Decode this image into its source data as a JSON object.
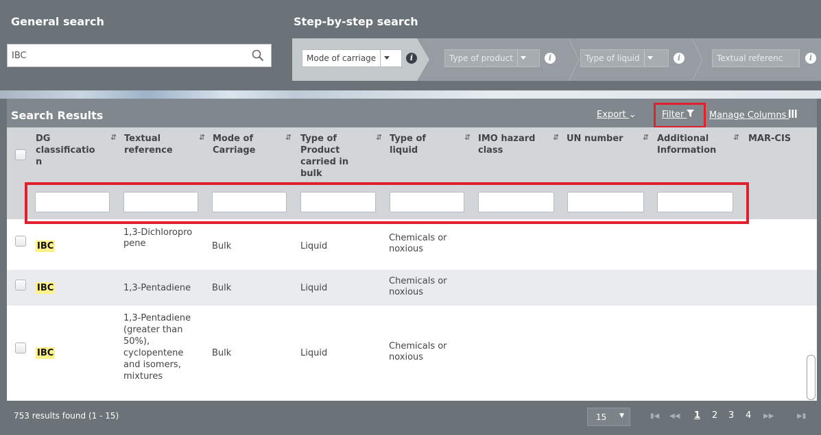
{
  "general_search": {
    "title": "General search",
    "value": "IBC"
  },
  "step_search": {
    "title": "Step-by-step search",
    "steps": [
      {
        "label": "Mode of carriage",
        "active": true
      },
      {
        "label": "Type of product",
        "active": false
      },
      {
        "label": "Type of liquid",
        "active": false
      },
      {
        "label": "Textual referenc",
        "active": false
      }
    ]
  },
  "results": {
    "title": "Search Results",
    "export_label": "Export",
    "filter_label": "Filter",
    "manage_columns_label": "Manage Columns"
  },
  "columns": [
    {
      "label": "DG classificatio n"
    },
    {
      "label": "Textual reference"
    },
    {
      "label": "Mode of Carriage"
    },
    {
      "label": "Type of Product carried in bulk"
    },
    {
      "label": "Type of liquid"
    },
    {
      "label": "IMO hazard class"
    },
    {
      "label": "UN number"
    },
    {
      "label": "Additional Information"
    },
    {
      "label": "MAR-CIS"
    }
  ],
  "rows": [
    {
      "dg": "IBC",
      "textual": "1,3-Dichloropropene",
      "mode": "Bulk",
      "product": "Liquid",
      "liquid": "Chemicals or noxious"
    },
    {
      "dg": "IBC",
      "textual": "1,3-Pentadiene",
      "mode": "Bulk",
      "product": "Liquid",
      "liquid": "Chemicals or noxious"
    },
    {
      "dg": "IBC",
      "textual": "1,3-Pentadiene (greater than 50%), cyclopentene and isomers, mixtures",
      "mode": "Bulk",
      "product": "Liquid",
      "liquid": "Chemicals or noxious"
    }
  ],
  "footer": {
    "count_text": "753 results found (1 - 15)",
    "page_size": "15",
    "pages": [
      "1",
      "2",
      "3",
      "4"
    ],
    "current_page": "1"
  },
  "colors": {
    "highlight_border": "#e0202c",
    "tag_highlight": "#fef18a",
    "header_bg": "#80878d"
  }
}
